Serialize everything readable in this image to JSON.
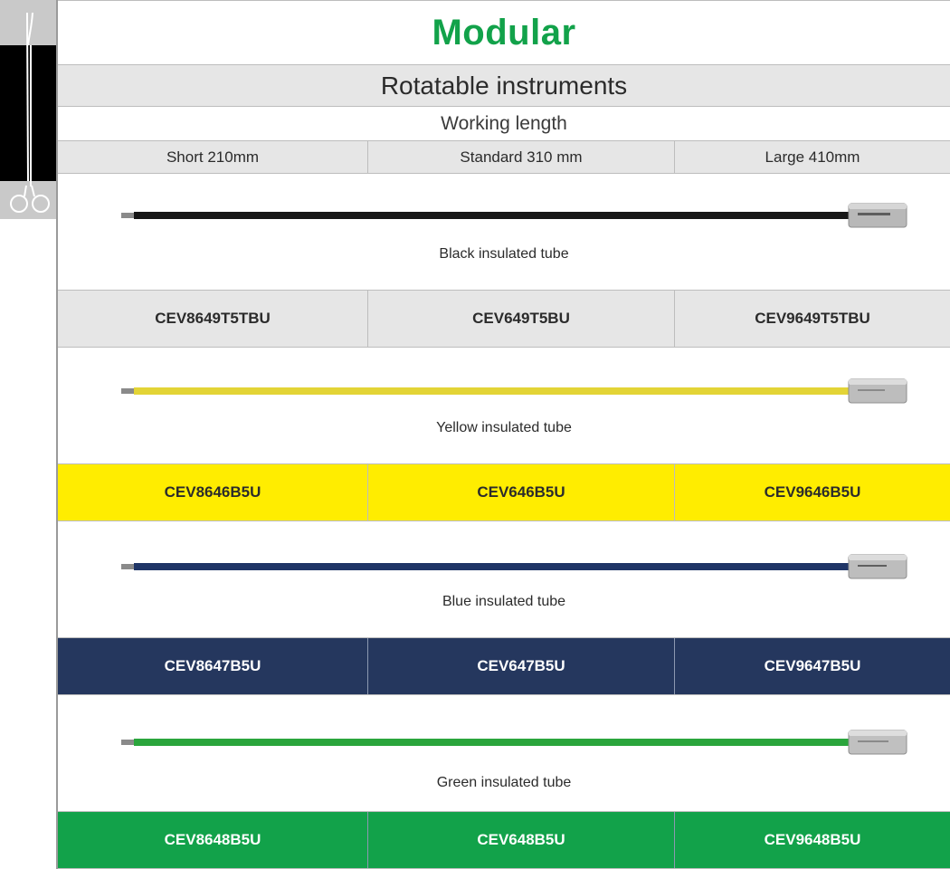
{
  "header": {
    "title": "Modular",
    "subtitle": "Rotatable instruments",
    "section_label": "Working length"
  },
  "lengths": [
    "Short 210mm",
    "Standard 310 mm",
    "Large 410mm"
  ],
  "products": [
    {
      "tube_label": "Black insulated tube",
      "tube_color": "#161616",
      "row_color": "#e6e6e6",
      "codes": [
        "CEV8649T5TBU",
        "CEV649T5BU",
        "CEV9649T5TBU"
      ]
    },
    {
      "tube_label": "Yellow insulated tube",
      "tube_color": "#e3d436",
      "row_color": "#ffed00",
      "codes": [
        "CEV8646B5U",
        "CEV646B5U",
        "CEV9646B5U"
      ]
    },
    {
      "tube_label": "Blue insulated tube",
      "tube_color": "#1f3566",
      "row_color": "#25375e",
      "codes": [
        "CEV8647B5U",
        "CEV647B5U",
        "CEV9647B5U"
      ]
    },
    {
      "tube_label": "Green insulated tube",
      "tube_color": "#2aa53c",
      "row_color": "#12a24a",
      "codes": [
        "CEV8648B5U",
        "CEV648B5U",
        "CEV9648B5U"
      ]
    }
  ],
  "side_tab": {
    "icon": "scissors-icon"
  }
}
